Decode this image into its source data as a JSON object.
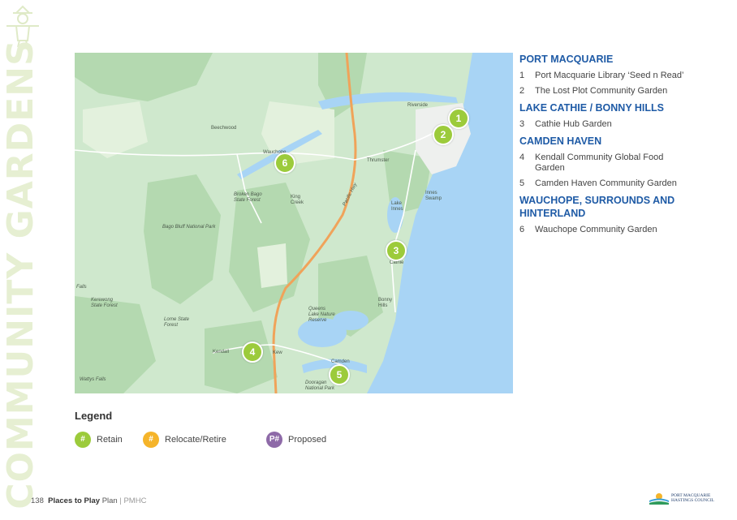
{
  "side_title": "COMMUNITY GARDENS",
  "map": {
    "place_labels": [
      {
        "id": "beechwood",
        "text": "Beechwood"
      },
      {
        "id": "wauchope",
        "text": "Wauchope"
      },
      {
        "id": "king-creek",
        "text": "King\nCreek"
      },
      {
        "id": "thrumster",
        "text": "Thrumster"
      },
      {
        "id": "riverside",
        "text": "Riverside"
      },
      {
        "id": "cathie",
        "text": "Cathie"
      },
      {
        "id": "bonny-hills",
        "text": "Bonny\nHills"
      },
      {
        "id": "kendall",
        "text": "Kendall"
      },
      {
        "id": "kew",
        "text": "Kew"
      },
      {
        "id": "camden",
        "text": "Camden"
      },
      {
        "id": "bago-bluff",
        "text": "Bago Bluff National Park"
      },
      {
        "id": "broken-bago",
        "text": "Broken Bago\nState Forest"
      },
      {
        "id": "kerewong",
        "text": "Kerewong\nState Forest"
      },
      {
        "id": "lorne",
        "text": "Lorne State\nForest"
      },
      {
        "id": "queens-lake",
        "text": "Queens\nLake Nature\nReserve"
      },
      {
        "id": "dooragan",
        "text": "Dooragan\nNational Park"
      },
      {
        "id": "lake-innes",
        "text": "Lake\nInnes"
      },
      {
        "id": "innes-swamp",
        "text": "Innes\nSwamp"
      },
      {
        "id": "wattys-falls",
        "text": "Wattys Falls"
      },
      {
        "id": "falls",
        "text": "Falls"
      },
      {
        "id": "pacific-hwy",
        "text": "Pacific Hwy"
      }
    ],
    "markers": [
      {
        "id": "1",
        "label": "1"
      },
      {
        "id": "2",
        "label": "2"
      },
      {
        "id": "3",
        "label": "3"
      },
      {
        "id": "4",
        "label": "4"
      },
      {
        "id": "5",
        "label": "5"
      },
      {
        "id": "6",
        "label": "6"
      }
    ],
    "colors": {
      "land": "#cfe8cd",
      "forest": "#b4d9b0",
      "water": "#a8d4f5",
      "highway": "#f0a35a",
      "road": "#ffffff",
      "urban": "#eef0ee",
      "marker": "#9ccb3b"
    }
  },
  "sidebar": [
    {
      "region": "PORT MACQUARIE",
      "items": [
        {
          "num": "1",
          "text": "Port Macquarie Library ‘Seed n Read’"
        },
        {
          "num": "2",
          "text": "The Lost Plot Community Garden"
        }
      ]
    },
    {
      "region": "LAKE CATHIE / BONNY HILLS",
      "items": [
        {
          "num": "3",
          "text": "Cathie Hub Garden"
        }
      ]
    },
    {
      "region": "CAMDEN HAVEN",
      "items": [
        {
          "num": "4",
          "text": "Kendall Community Global Food Garden"
        },
        {
          "num": "5",
          "text": "Camden Haven Community Garden"
        }
      ]
    },
    {
      "region": "WAUCHOPE, SURROUNDS AND HINTERLAND",
      "items": [
        {
          "num": "6",
          "text": "Wauchope Community Garden"
        }
      ]
    }
  ],
  "legend": {
    "title": "Legend",
    "items": [
      {
        "symbol": "#",
        "label": "Retain",
        "color": "#9ccb3b"
      },
      {
        "symbol": "#",
        "label": "Relocate/Retire",
        "color": "#f5b42a"
      },
      {
        "symbol": "P#",
        "label": "Proposed",
        "color": "#8e6aa8"
      }
    ]
  },
  "footer": {
    "page": "138",
    "title_bold": "Places to Play",
    "title_rest": "Plan",
    "separator": "|",
    "org": "PMHC"
  },
  "council": {
    "line1": "PORT MACQUARIE",
    "line2": "HASTINGS COUNCIL"
  }
}
